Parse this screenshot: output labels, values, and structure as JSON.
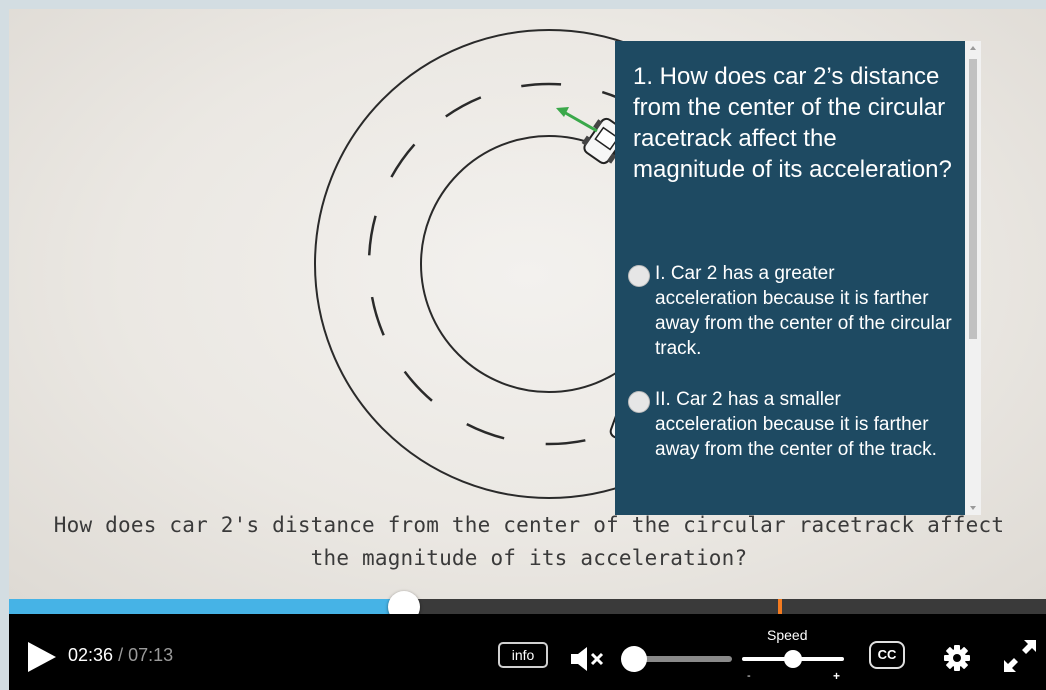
{
  "lesson": {
    "subtitle": "How does car 2's distance from the center of the circular racetrack affect the magnitude of its acceleration?"
  },
  "quiz": {
    "question": "1. How does car 2’s distance from the center of the circular racetrack affect the magnitude of its acceleration?",
    "options": [
      {
        "first": "I. Car 2 has a greater",
        "rest": "acceleration because it is farther away from the center of the circular track."
      },
      {
        "first": "II. Car 2 has a smaller",
        "rest": "acceleration because it is farther away from the center of the track."
      }
    ]
  },
  "player": {
    "current_time": "02:36",
    "duration": "07:13",
    "played_fraction": 0.381,
    "marker_fraction": 0.742,
    "volume_fraction": 0.0,
    "speed_fraction": 0.5,
    "info_label": "info",
    "speed_label": "Speed",
    "speed_minus": "-",
    "speed_plus": "+",
    "cc_label": "CC"
  },
  "colors": {
    "progress_played": "#46b3e6",
    "progress_marker": "#f47b20",
    "quiz_background": "#1e4a62"
  },
  "icons": {
    "play": "play-icon",
    "mute": "volume-muted-icon",
    "settings": "gear-icon",
    "fullscreen": "fullscreen-icon"
  }
}
